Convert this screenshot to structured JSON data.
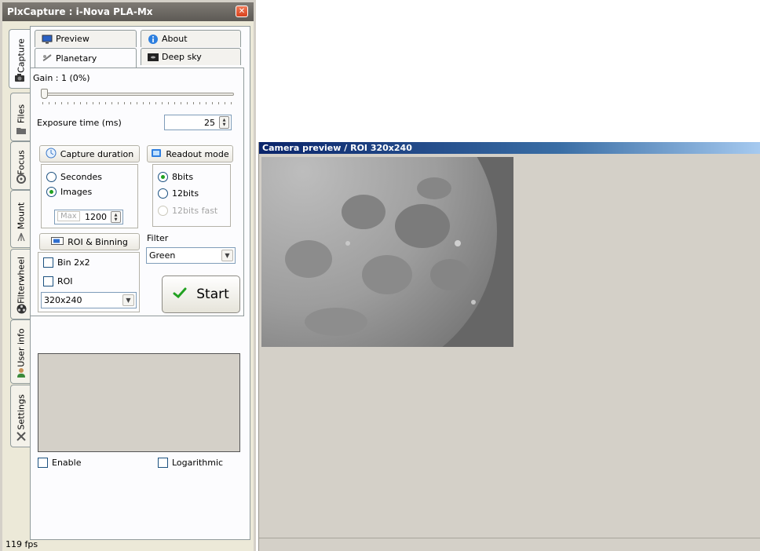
{
  "window": {
    "title": "PlxCapture : i-Nova PLA-Mx",
    "close_glyph": "✕"
  },
  "side_tabs": [
    {
      "label": "Capture",
      "icon": "camera-icon",
      "active": true
    },
    {
      "label": "Files",
      "icon": "folder-icon"
    },
    {
      "label": "Focus",
      "icon": "focus-icon"
    },
    {
      "label": "Mount",
      "icon": "telescope-icon"
    },
    {
      "label": "Filterwheel",
      "icon": "filterwheel-icon"
    },
    {
      "label": "User info",
      "icon": "user-icon"
    },
    {
      "label": "Settings",
      "icon": "tools-icon"
    }
  ],
  "top_tabs": {
    "preview": "Preview",
    "about": "About",
    "planetary": "Planetary",
    "deep_sky": "Deep sky",
    "active": "Planetary"
  },
  "capture": {
    "gain_label": "Gain : 1 (0%)",
    "gain_percent": 0,
    "exposure_label": "Exposure time (ms)",
    "exposure_value": "25",
    "duration": {
      "title": "Capture duration",
      "option_seconds": "Secondes",
      "option_images": "Images",
      "selected": "Images",
      "max_label": "Max",
      "max_value": "1200"
    },
    "readout": {
      "title": "Readout mode",
      "option_8bits": "8bits",
      "option_12bits": "12bits",
      "option_12bits_fast": "12bits fast",
      "selected": "8bits"
    },
    "roi": {
      "title": "ROI & Binning",
      "bin_label": "Bin 2x2",
      "roi_label": "ROI",
      "size_value": "320x240"
    },
    "filter": {
      "label": "Filter",
      "value": "Green"
    },
    "start_label": "Start"
  },
  "histogram": {
    "enable_label": "Enable",
    "log_label": "Logarithmic"
  },
  "status": {
    "fps": "119 fps"
  },
  "preview": {
    "title": "Camera preview / ROI 320x240"
  },
  "colors": {
    "accent_green": "#21a121",
    "titlebar": "#5d5a55",
    "preview_title": "#0a246a"
  }
}
